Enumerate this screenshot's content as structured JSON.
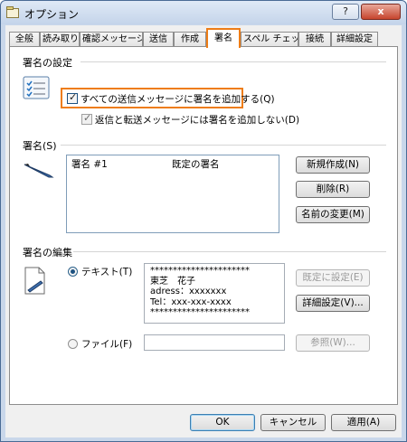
{
  "window": {
    "title": "オプション",
    "help_label": "?",
    "close_label": "x"
  },
  "tabs": [
    {
      "label": "全般"
    },
    {
      "label": "読み取り"
    },
    {
      "label": "確認メッセージ"
    },
    {
      "label": "送信"
    },
    {
      "label": "作成"
    },
    {
      "label": "署名",
      "active": true
    },
    {
      "label": "スペル チェック"
    },
    {
      "label": "接続"
    },
    {
      "label": "詳細設定"
    }
  ],
  "settings_section": {
    "title": "署名の設定",
    "option1": {
      "label": "すべての送信メッセージに署名を追加する(Q)",
      "checked": true
    },
    "option2": {
      "label": "返信と転送メッセージには署名を追加しない(D)",
      "checked": true,
      "enabled": false
    }
  },
  "signature_section": {
    "title": "署名(S)",
    "list": {
      "name": "署名 #1",
      "default_label": "既定の署名"
    },
    "new_button": "新規作成(N)",
    "delete_button": "削除(R)",
    "rename_button": "名前の変更(M)"
  },
  "edit_section": {
    "title": "署名の編集",
    "text_radio": {
      "label": "テキスト(T)",
      "selected": true
    },
    "text_lines": [
      "**********************",
      "東芝　花子",
      "adress：xxxxxxx",
      "Tel：xxx-xxx-xxxx",
      "**********************"
    ],
    "set_default_button": "既定に設定(E)",
    "advanced_button": "詳細設定(V)...",
    "file_radio": {
      "label": "ファイル(F)",
      "selected": false
    },
    "file_value": "",
    "browse_button": "参照(W)..."
  },
  "footer": {
    "ok": "OK",
    "cancel": "キャンセル",
    "apply": "適用(A)"
  },
  "colors": {
    "highlight": "#ee7d17",
    "accent": "#1c5180"
  }
}
